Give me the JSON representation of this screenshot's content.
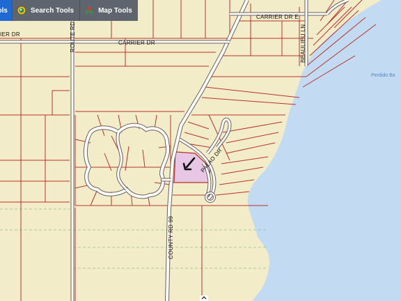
{
  "toolbar": {
    "tools_label": "ols",
    "search_label": "Search Tools",
    "map_label": "Map Tools",
    "search_icon": "globe-icon",
    "map_icon": "map-pin-icon"
  },
  "map": {
    "land_color": "#f3ecc9",
    "water_color": "#c2dbf2",
    "road_color": "#ffffff",
    "parcel_line_color": "#b8322c",
    "highlight_color": "#e7c6e6",
    "arrow_icon": "arrow-down-left-icon",
    "labels": {
      "carrier_dr_e": "CARRIER DR E",
      "carrier_dr_left": "IER DR",
      "carrier_dr": "CARRIER DR",
      "route_rd": "ROUTE RD",
      "beaulieu_ln": "BEAULIEU LN",
      "perdido_bay": "Perdido Ba",
      "palao_dr": "PALAO DR",
      "county_rd": "COUNTY RD 99"
    }
  }
}
